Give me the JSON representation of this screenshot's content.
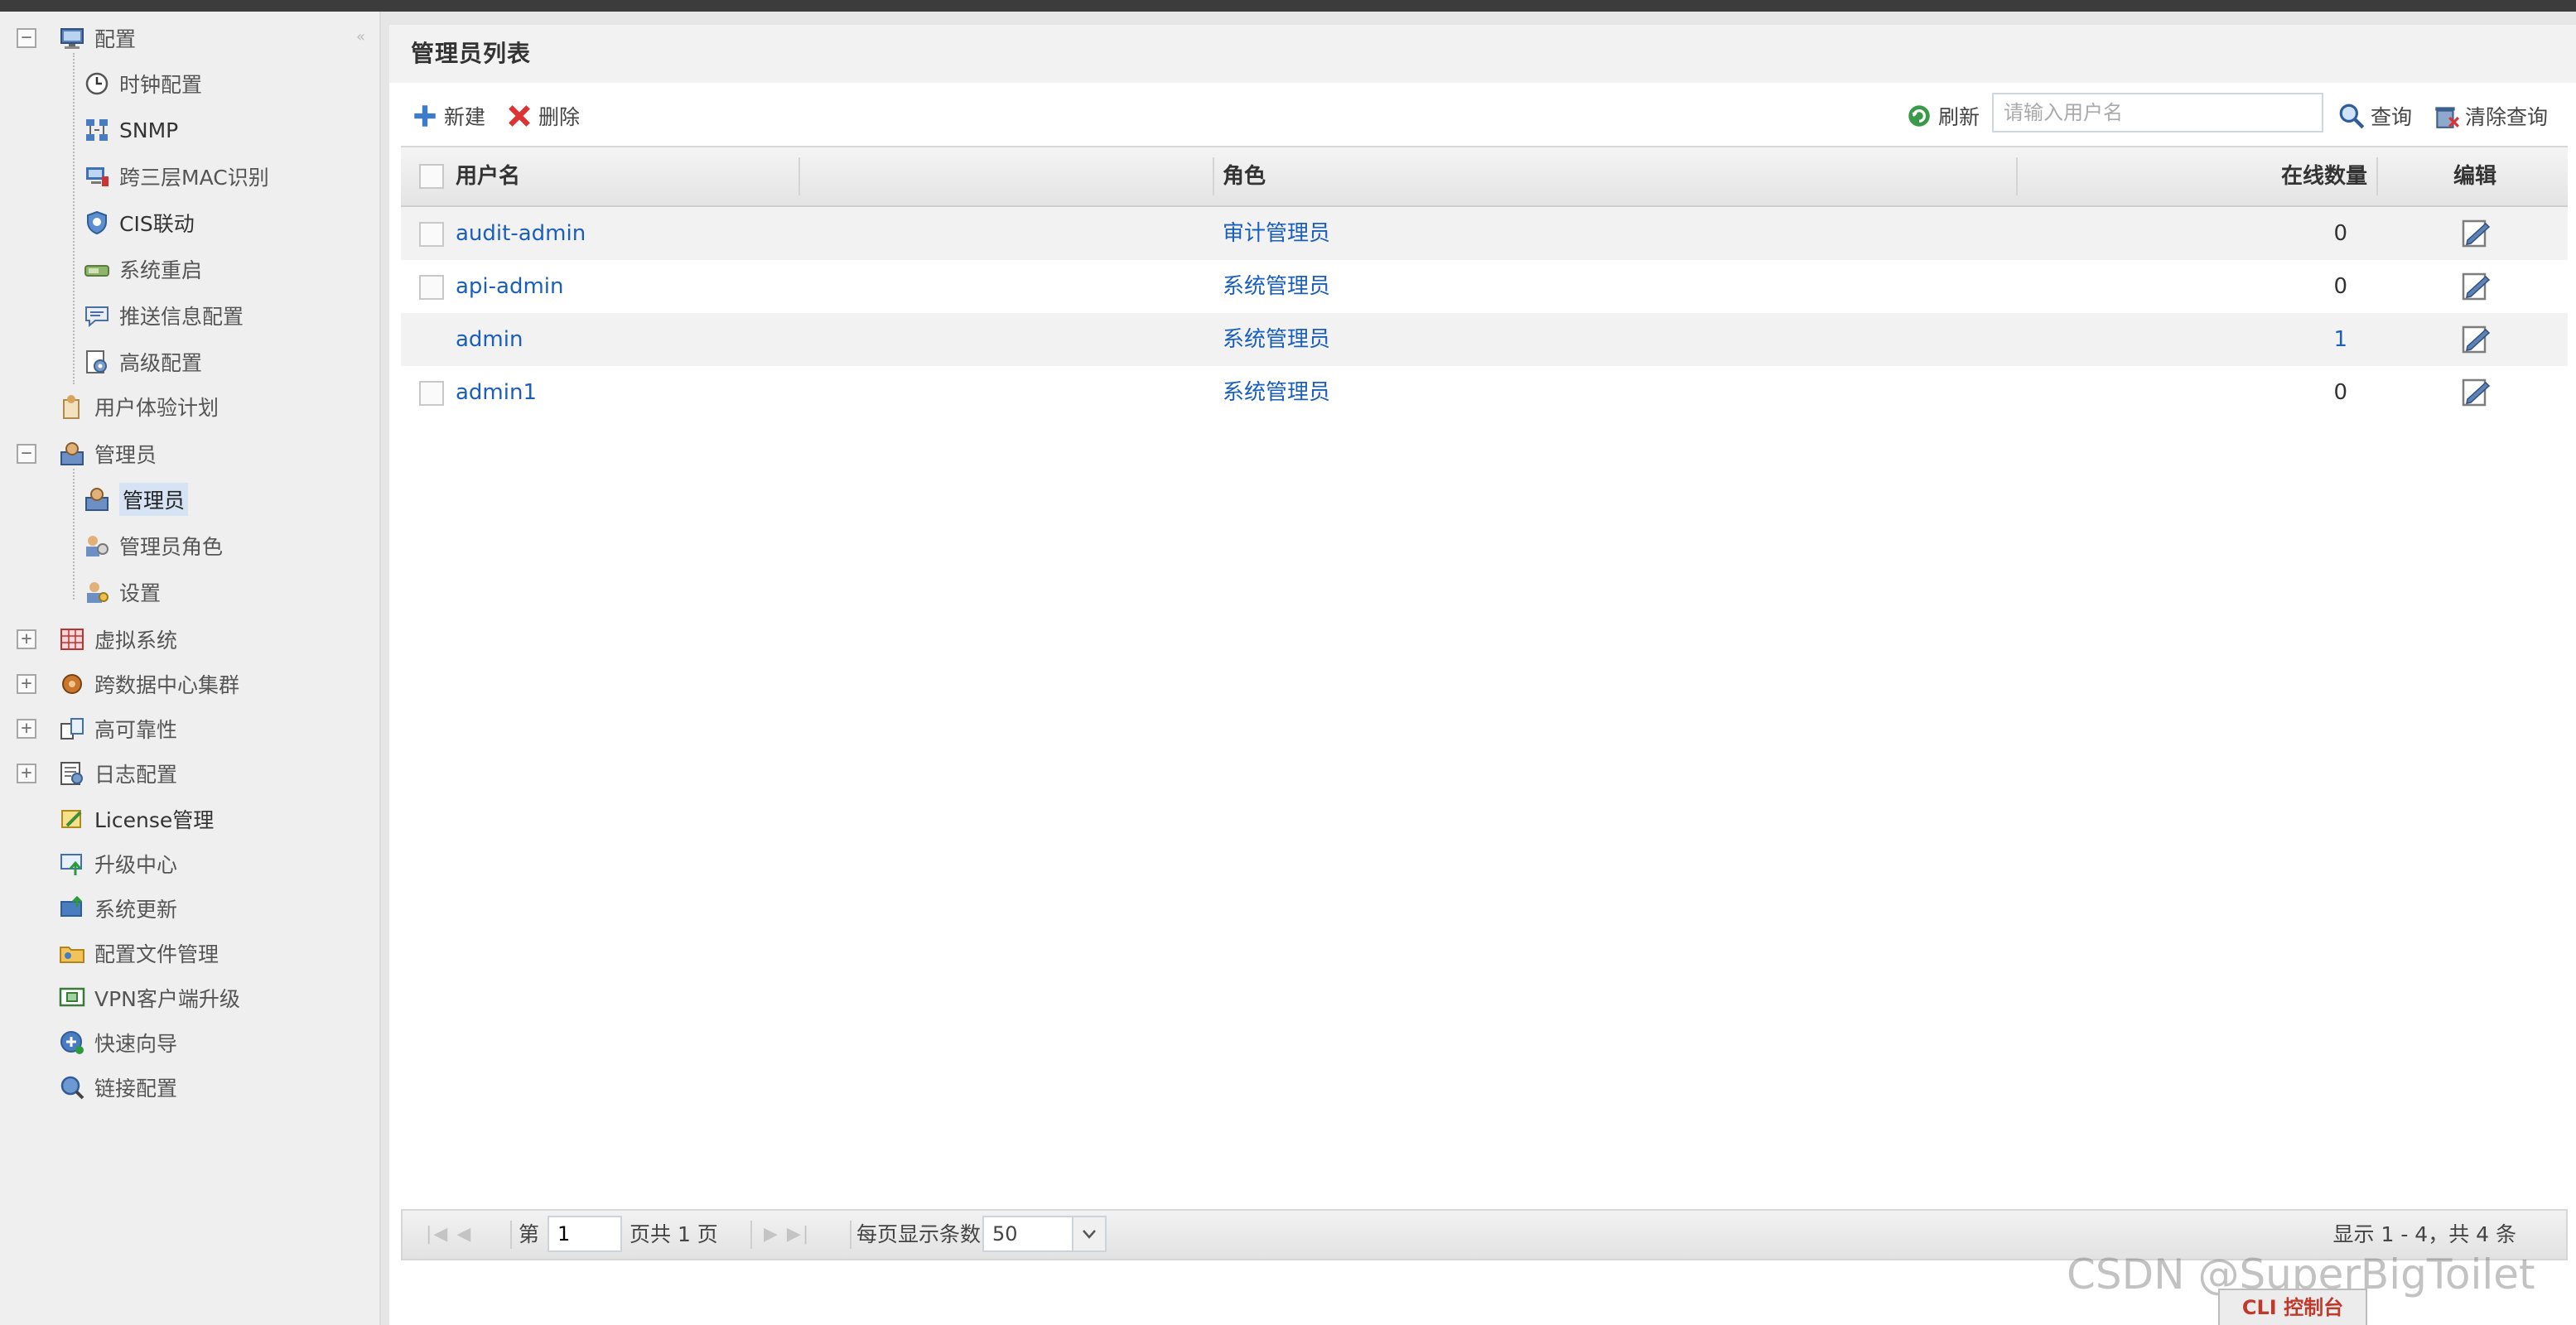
{
  "sidebar": {
    "items": [
      {
        "label": "配置",
        "icon": "monitor-icon",
        "toggle": "−"
      },
      {
        "label": "时钟配置",
        "icon": "clock-icon"
      },
      {
        "label": "SNMP",
        "icon": "network-icon"
      },
      {
        "label": "跨三层MAC识别",
        "icon": "pc-icon"
      },
      {
        "label": "CIS联动",
        "icon": "shield-link-icon"
      },
      {
        "label": "系统重启",
        "icon": "power-icon"
      },
      {
        "label": "推送信息配置",
        "icon": "message-icon"
      },
      {
        "label": "高级配置",
        "icon": "settings-doc-icon"
      },
      {
        "label": "用户体验计划",
        "icon": "user-doc-icon"
      },
      {
        "label": "管理员",
        "icon": "admin-icon",
        "toggle": "−"
      },
      {
        "label": "管理员",
        "icon": "admin-icon"
      },
      {
        "label": "管理员角色",
        "icon": "users-role-icon"
      },
      {
        "label": "设置",
        "icon": "user-gear-icon"
      },
      {
        "label": "虚拟系统",
        "icon": "virtual-system-icon",
        "toggle": "+"
      },
      {
        "label": "跨数据中心集群",
        "icon": "cluster-icon",
        "toggle": "+"
      },
      {
        "label": "高可靠性",
        "icon": "ha-icon",
        "toggle": "+"
      },
      {
        "label": "日志配置",
        "icon": "log-icon",
        "toggle": "+"
      },
      {
        "label": "License管理",
        "icon": "license-icon"
      },
      {
        "label": "升级中心",
        "icon": "upgrade-icon"
      },
      {
        "label": "系统更新",
        "icon": "update-icon"
      },
      {
        "label": "配置文件管理",
        "icon": "folder-icon"
      },
      {
        "label": "VPN客户端升级",
        "icon": "vpn-icon"
      },
      {
        "label": "快速向导",
        "icon": "wizard-icon"
      },
      {
        "label": "链接配置",
        "icon": "link-search-icon"
      }
    ]
  },
  "panel": {
    "title": "管理员列表"
  },
  "toolbar": {
    "new_label": "新建",
    "delete_label": "删除",
    "refresh_label": "刷新",
    "search_placeholder": "请输入用户名",
    "query_label": "查询",
    "clear_query_label": "清除查询"
  },
  "table": {
    "columns": [
      "用户名",
      "角色",
      "在线数量",
      "编辑"
    ],
    "rows": [
      {
        "username": "audit-admin",
        "role": "审计管理员",
        "online": "0",
        "checkbox": true
      },
      {
        "username": "api-admin",
        "role": "系统管理员",
        "online": "0",
        "checkbox": true
      },
      {
        "username": "admin",
        "role": "系统管理员",
        "online": "1",
        "checkbox": false
      },
      {
        "username": "admin1",
        "role": "系统管理员",
        "online": "0",
        "checkbox": true
      }
    ]
  },
  "pager": {
    "first_prev": "|◀ ◀",
    "page_prefix": "第",
    "page_value": "1",
    "page_suffix": "页共 1 页",
    "next_last": "▶ ▶|",
    "page_size_label": "每页显示条数",
    "page_size_value": "50",
    "summary": "显示 1 - 4，共 4 条"
  },
  "watermark": "CSDN @SuperBigToilet",
  "cli_button": "CLI 控制台",
  "colors": {
    "link": "#1a5fbd",
    "cli_text": "#c0392b",
    "selected_bg": "#d5e3f5"
  }
}
